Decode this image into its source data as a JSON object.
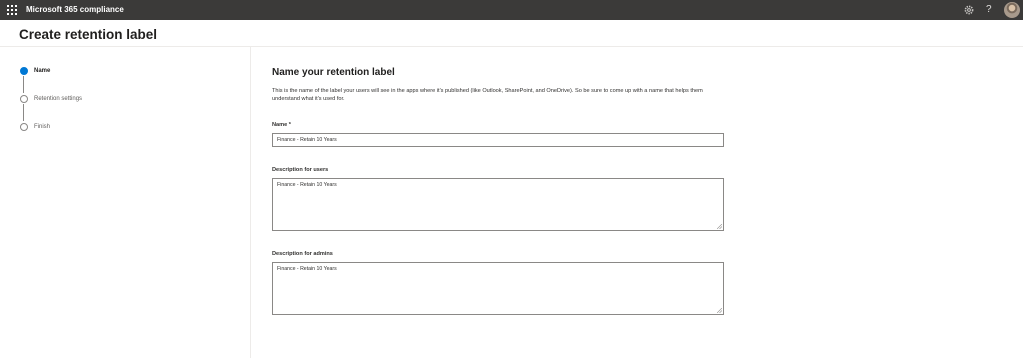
{
  "topbar": {
    "app_title": "Microsoft 365 compliance",
    "help_label": "?",
    "icons": [
      "waffle-icon",
      "gear-icon",
      "avatar"
    ]
  },
  "page": {
    "title": "Create retention label"
  },
  "steps": [
    {
      "label": "Name",
      "state": "current"
    },
    {
      "label": "Retention settings",
      "state": "pending"
    },
    {
      "label": "Finish",
      "state": "pending"
    }
  ],
  "form": {
    "title": "Name your retention label",
    "description": "This is the name of the label your users will see in the apps where it's published (like Outlook, SharePoint, and OneDrive). So be sure to come up with a name that helps them understand what it's used for.",
    "name_label": "Name *",
    "name_value": "Finance - Retain 10 Years",
    "users_desc_label": "Description for users",
    "users_desc_value": "Finance - Retain 10 Years",
    "admins_desc_label": "Description for admins",
    "admins_desc_value": "Finance - Retain 10 Years"
  },
  "colors": {
    "topbar_bg": "#3b3a39",
    "accent": "#0078d4",
    "border": "#8a8886"
  }
}
